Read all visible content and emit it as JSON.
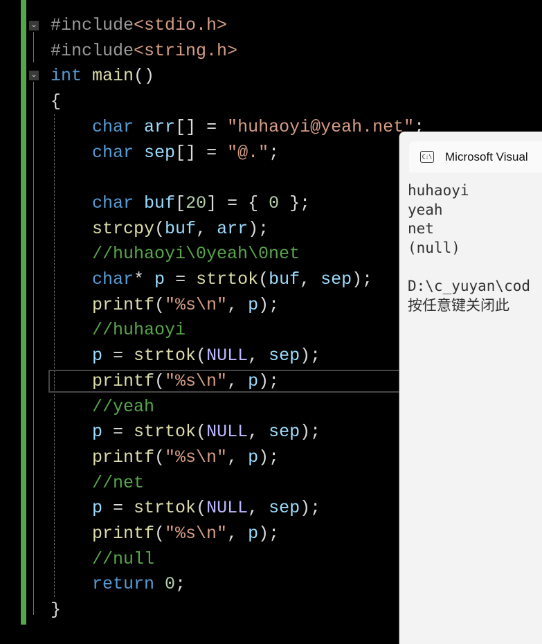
{
  "editor": {
    "lines": [
      [
        [
          "pp",
          "#include"
        ],
        [
          "str",
          "<stdio.h>"
        ]
      ],
      [
        [
          "pp",
          "#include"
        ],
        [
          "str",
          "<string.h>"
        ]
      ],
      [
        [
          "kw",
          "int"
        ],
        [
          "pl",
          " "
        ],
        [
          "fn",
          "main"
        ],
        [
          "pl",
          "()"
        ]
      ],
      [
        [
          "pl",
          "{"
        ]
      ],
      [
        [
          "pl",
          "    "
        ],
        [
          "kw",
          "char"
        ],
        [
          "pl",
          " "
        ],
        [
          "var",
          "arr"
        ],
        [
          "pl",
          "[] = "
        ],
        [
          "str",
          "\"huhaoyi@yeah.net\""
        ],
        [
          "pl",
          ";"
        ]
      ],
      [
        [
          "pl",
          "    "
        ],
        [
          "kw",
          "char"
        ],
        [
          "pl",
          " "
        ],
        [
          "var",
          "sep"
        ],
        [
          "pl",
          "[] = "
        ],
        [
          "str",
          "\"@.\""
        ],
        [
          "pl",
          ";"
        ]
      ],
      [],
      [
        [
          "pl",
          "    "
        ],
        [
          "kw",
          "char"
        ],
        [
          "pl",
          " "
        ],
        [
          "var",
          "buf"
        ],
        [
          "pl",
          "["
        ],
        [
          "num",
          "20"
        ],
        [
          "pl",
          "] = { "
        ],
        [
          "num",
          "0"
        ],
        [
          "pl",
          " };"
        ]
      ],
      [
        [
          "pl",
          "    "
        ],
        [
          "fn",
          "strcpy"
        ],
        [
          "pl",
          "("
        ],
        [
          "var",
          "buf"
        ],
        [
          "pl",
          ", "
        ],
        [
          "var",
          "arr"
        ],
        [
          "pl",
          ");"
        ]
      ],
      [
        [
          "pl",
          "    "
        ],
        [
          "cm",
          "//huhaoyi\\0yeah\\0net"
        ]
      ],
      [
        [
          "pl",
          "    "
        ],
        [
          "kw",
          "char"
        ],
        [
          "pl",
          "* "
        ],
        [
          "var",
          "p"
        ],
        [
          "pl",
          " = "
        ],
        [
          "fn",
          "strtok"
        ],
        [
          "pl",
          "("
        ],
        [
          "var",
          "buf"
        ],
        [
          "pl",
          ", "
        ],
        [
          "var",
          "sep"
        ],
        [
          "pl",
          ");"
        ]
      ],
      [
        [
          "pl",
          "    "
        ],
        [
          "fn",
          "printf"
        ],
        [
          "pl",
          "("
        ],
        [
          "str",
          "\"%s\\n\""
        ],
        [
          "pl",
          ", "
        ],
        [
          "var",
          "p"
        ],
        [
          "pl",
          ");"
        ]
      ],
      [
        [
          "pl",
          "    "
        ],
        [
          "cm",
          "//huhaoyi"
        ]
      ],
      [
        [
          "pl",
          "    "
        ],
        [
          "var",
          "p"
        ],
        [
          "pl",
          " = "
        ],
        [
          "fn",
          "strtok"
        ],
        [
          "pl",
          "("
        ],
        [
          "mac",
          "NULL"
        ],
        [
          "pl",
          ", "
        ],
        [
          "var",
          "sep"
        ],
        [
          "pl",
          ");"
        ]
      ],
      [
        [
          "pl",
          "    "
        ],
        [
          "fn",
          "printf"
        ],
        [
          "pl",
          "("
        ],
        [
          "str",
          "\"%s\\n\""
        ],
        [
          "pl",
          ", "
        ],
        [
          "var",
          "p"
        ],
        [
          "pl",
          ");"
        ]
      ],
      [
        [
          "pl",
          "    "
        ],
        [
          "cm",
          "//yeah"
        ]
      ],
      [
        [
          "pl",
          "    "
        ],
        [
          "var",
          "p"
        ],
        [
          "pl",
          " = "
        ],
        [
          "fn",
          "strtok"
        ],
        [
          "pl",
          "("
        ],
        [
          "mac",
          "NULL"
        ],
        [
          "pl",
          ", "
        ],
        [
          "var",
          "sep"
        ],
        [
          "pl",
          ");"
        ]
      ],
      [
        [
          "pl",
          "    "
        ],
        [
          "fn",
          "printf"
        ],
        [
          "pl",
          "("
        ],
        [
          "str",
          "\"%s\\n\""
        ],
        [
          "pl",
          ", "
        ],
        [
          "var",
          "p"
        ],
        [
          "pl",
          ");"
        ]
      ],
      [
        [
          "pl",
          "    "
        ],
        [
          "cm",
          "//net"
        ]
      ],
      [
        [
          "pl",
          "    "
        ],
        [
          "var",
          "p"
        ],
        [
          "pl",
          " = "
        ],
        [
          "fn",
          "strtok"
        ],
        [
          "pl",
          "("
        ],
        [
          "mac",
          "NULL"
        ],
        [
          "pl",
          ", "
        ],
        [
          "var",
          "sep"
        ],
        [
          "pl",
          ");"
        ]
      ],
      [
        [
          "pl",
          "    "
        ],
        [
          "fn",
          "printf"
        ],
        [
          "pl",
          "("
        ],
        [
          "str",
          "\"%s\\n\""
        ],
        [
          "pl",
          ", "
        ],
        [
          "var",
          "p"
        ],
        [
          "pl",
          ");"
        ]
      ],
      [
        [
          "pl",
          "    "
        ],
        [
          "cm",
          "//null"
        ]
      ],
      [
        [
          "pl",
          "    "
        ],
        [
          "kw",
          "return"
        ],
        [
          "pl",
          " "
        ],
        [
          "num",
          "0"
        ],
        [
          "pl",
          ";"
        ]
      ],
      [
        [
          "pl",
          "}"
        ]
      ]
    ]
  },
  "console": {
    "title": "Microsoft Visual",
    "icon_text": "C:\\",
    "output": "huhaoyi\nyeah\nnet\n(null)\n\nD:\\c_yuyan\\cod\n按任意键关闭此"
  },
  "colors": {
    "change_bar": "#57a64a",
    "background": "#000000",
    "console_bg": "#f3f3f3"
  }
}
